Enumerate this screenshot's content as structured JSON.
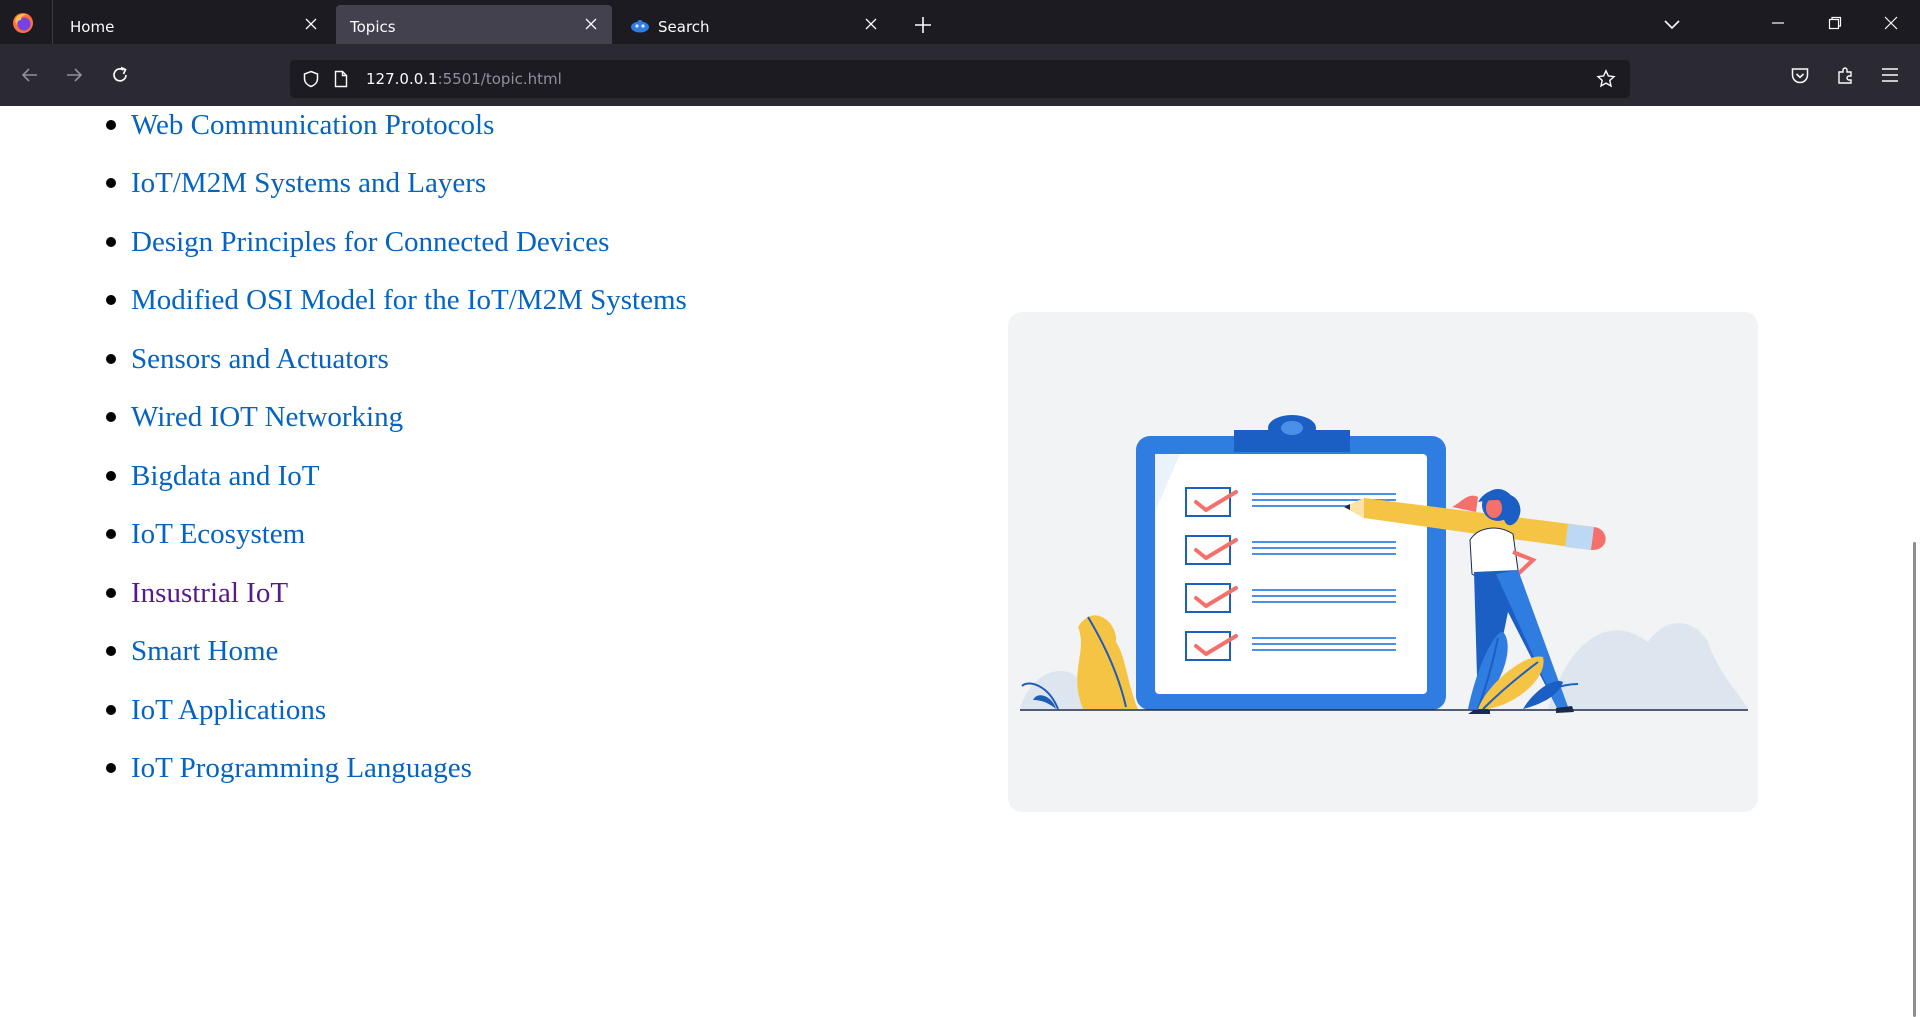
{
  "browser": {
    "tabs": [
      {
        "title": "Home",
        "active": false
      },
      {
        "title": "Topics",
        "active": true
      },
      {
        "title": "Search",
        "active": false
      }
    ],
    "url": {
      "host": "127.0.0.1",
      "rest": ":5501/topic.html"
    }
  },
  "page": {
    "topics": [
      {
        "label": "Web Communication Protocols",
        "visited": false
      },
      {
        "label": "IoT/M2M Systems and Layers",
        "visited": false
      },
      {
        "label": "Design Principles for Connected Devices",
        "visited": false
      },
      {
        "label": "Modified OSI Model for the IoT/M2M Systems",
        "visited": false
      },
      {
        "label": "Sensors and Actuators",
        "visited": false
      },
      {
        "label": "Wired IOT Networking",
        "visited": false
      },
      {
        "label": "Bigdata and IoT",
        "visited": false
      },
      {
        "label": "IoT Ecosystem",
        "visited": false
      },
      {
        "label": "Insustrial IoT",
        "visited": true
      },
      {
        "label": "Smart Home",
        "visited": false
      },
      {
        "label": "IoT Applications",
        "visited": false
      },
      {
        "label": "IoT Programming Languages",
        "visited": false
      }
    ]
  },
  "colors": {
    "link": "#0563c1",
    "visited_link": "#551a8b",
    "tabbar": "#1c1b22",
    "navbar": "#2b2a33"
  },
  "icons": {
    "browser": "firefox-logo-icon",
    "search_tab": "search-favicon-icon"
  }
}
